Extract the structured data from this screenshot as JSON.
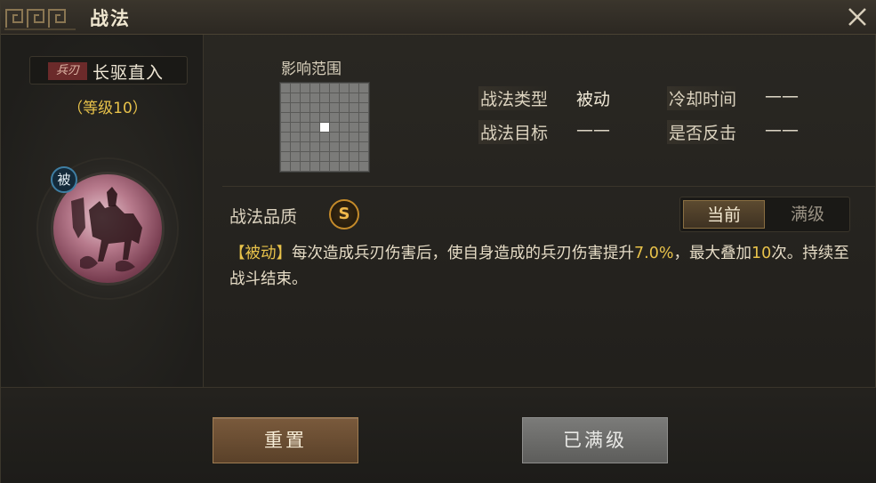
{
  "window": {
    "title": "战法"
  },
  "skill": {
    "weapon_tag": "兵刃",
    "name": "长驱直入",
    "level": "（等级10）",
    "passive_badge": "被"
  },
  "range": {
    "label": "影响范围"
  },
  "info": {
    "type_label": "战法类型",
    "type_value": "被动",
    "target_label": "战法目标",
    "target_value": "——",
    "cooldown_label": "冷却时间",
    "cooldown_value": "——",
    "counter_label": "是否反击",
    "counter_value": "——"
  },
  "quality": {
    "label": "战法品质",
    "grade": "S"
  },
  "toggle": {
    "current_label": "当前",
    "max_label": "满级"
  },
  "description": {
    "tag": "【被动】",
    "part1": "每次造成兵刃伤害后，使自身造成的兵刃伤害提升",
    "pct": "7.0%",
    "part2": "，最大叠加",
    "times": "10",
    "part3": "次。持续至战斗结束。"
  },
  "buttons": {
    "reset_label": "重置",
    "maxed_label": "已满级"
  },
  "colors": {
    "accent_gold": "#e8c24a",
    "weapon_tag_bg": "#6b2a2a",
    "grid_center": "#ffffff"
  }
}
